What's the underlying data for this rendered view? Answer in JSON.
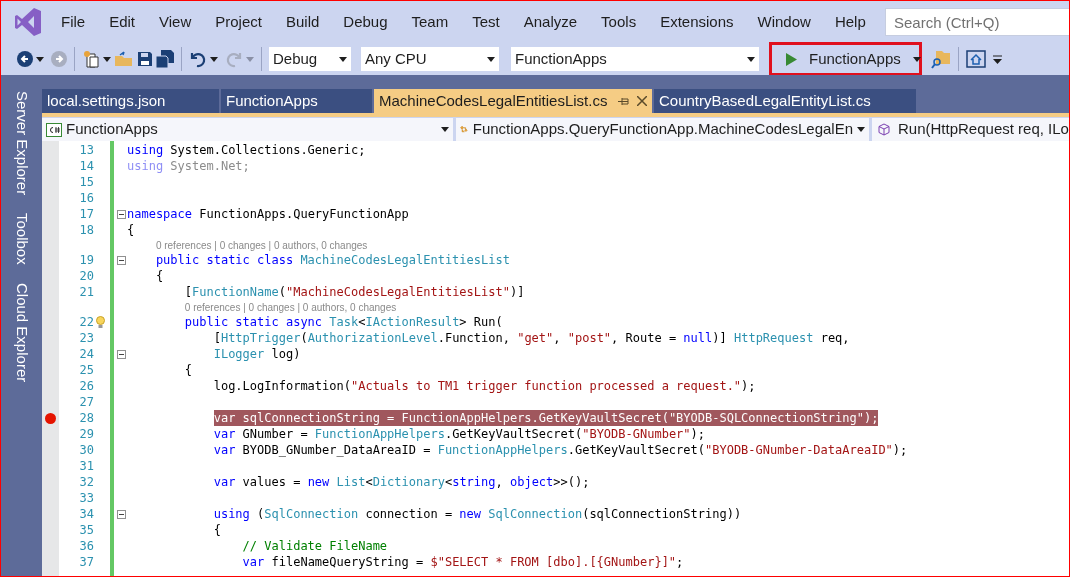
{
  "menu": [
    {
      "label": "File"
    },
    {
      "label": "Edit"
    },
    {
      "label": "View"
    },
    {
      "label": "Project"
    },
    {
      "label": "Build"
    },
    {
      "label": "Debug"
    },
    {
      "label": "Team"
    },
    {
      "label": "Test"
    },
    {
      "label": "Analyze"
    },
    {
      "label": "Tools"
    },
    {
      "label": "Extensions"
    },
    {
      "label": "Window"
    },
    {
      "label": "Help"
    }
  ],
  "search": {
    "placeholder": "Search (Ctrl+Q)"
  },
  "toolbar": {
    "configuration": "Debug",
    "platform": "Any CPU",
    "startup_project": "FunctionApps",
    "run_button": "FunctionApps"
  },
  "tool_windows": [
    "Server Explorer",
    "Toolbox",
    "Cloud Explorer"
  ],
  "tabs": [
    {
      "label": "local.settings.json",
      "selected": false
    },
    {
      "label": "FunctionApps",
      "selected": false
    },
    {
      "label": "MachineCodesLegalEntitiesList.cs",
      "selected": true
    },
    {
      "label": "CountryBasedLegalEntityList.cs",
      "selected": false
    }
  ],
  "nav_bar": {
    "project": "FunctionApps",
    "type": "FunctionApps.QueryFunctionApp.MachineCodesLegalEn",
    "member": "Run(HttpRequest req, ILo"
  },
  "code_lines": [
    {
      "kind": "code",
      "number": "13",
      "tokens": [
        {
          "kind": "keyword",
          "text": "using"
        },
        {
          "kind": "plain",
          "text": " System.Collections.Generic;"
        }
      ]
    },
    {
      "kind": "code",
      "number": "14",
      "tokens": [
        {
          "kind": "unused_keyword",
          "text": "using"
        },
        {
          "kind": "unused",
          "text": " System.Net;"
        }
      ]
    },
    {
      "kind": "code",
      "number": "15"
    },
    {
      "kind": "code",
      "number": "16"
    },
    {
      "kind": "code",
      "number": "17",
      "fold": true,
      "tokens": [
        {
          "kind": "keyword",
          "text": "namespace"
        },
        {
          "kind": "plain",
          "text": " FunctionApps.QueryFunctionApp"
        }
      ]
    },
    {
      "kind": "code",
      "number": "18",
      "tokens": [
        {
          "kind": "plain",
          "text": "{"
        }
      ]
    },
    {
      "kind": "block",
      "children": [
        {
          "kind": "lens",
          "text": "0 references | 0 changes | 0 authors, 0 changes"
        },
        {
          "kind": "code",
          "number": "19",
          "fold": true,
          "tokens": [
            {
              "kind": "keyword",
              "text": "public static class"
            },
            {
              "kind": "type",
              "text": " MachineCodesLegalEntitiesList"
            }
          ]
        },
        {
          "kind": "code",
          "number": "20",
          "tokens": [
            {
              "kind": "plain",
              "text": "{"
            }
          ]
        },
        {
          "kind": "block",
          "children": [
            {
              "kind": "code",
              "number": "21",
              "tokens": [
                {
                  "kind": "plain",
                  "text": "["
                },
                {
                  "kind": "type",
                  "text": "FunctionName"
                },
                {
                  "kind": "plain",
                  "text": "("
                },
                {
                  "kind": "string",
                  "text": "\"MachineCodesLegalEntitiesList\""
                },
                {
                  "kind": "plain",
                  "text": ")]"
                }
              ]
            },
            {
              "kind": "lens",
              "text": "0 references | 0 changes | 0 authors, 0 changes"
            },
            {
              "kind": "code",
              "number": "22",
              "lightbulb": true,
              "tokens": [
                {
                  "kind": "keyword",
                  "text": "public static async "
                },
                {
                  "kind": "type",
                  "text": "Task"
                },
                {
                  "kind": "plain",
                  "text": "<"
                },
                {
                  "kind": "type",
                  "text": "IActionResult"
                },
                {
                  "kind": "plain",
                  "text": "> Run("
                }
              ]
            },
            {
              "kind": "block",
              "children": [
                {
                  "kind": "code",
                  "number": "23",
                  "tokens": [
                    {
                      "kind": "plain",
                      "text": "["
                    },
                    {
                      "kind": "type",
                      "text": "HttpTrigger"
                    },
                    {
                      "kind": "plain",
                      "text": "("
                    },
                    {
                      "kind": "type",
                      "text": "AuthorizationLevel"
                    },
                    {
                      "kind": "plain",
                      "text": ".Function, "
                    },
                    {
                      "kind": "string",
                      "text": "\"get\""
                    },
                    {
                      "kind": "plain",
                      "text": ", "
                    },
                    {
                      "kind": "string",
                      "text": "\"post\""
                    },
                    {
                      "kind": "plain",
                      "text": ", Route = "
                    },
                    {
                      "kind": "keyword",
                      "text": "null"
                    },
                    {
                      "kind": "plain",
                      "text": ")] "
                    },
                    {
                      "kind": "type",
                      "text": "HttpRequest"
                    },
                    {
                      "kind": "plain",
                      "text": " req,"
                    }
                  ]
                },
                {
                  "kind": "code",
                  "number": "24",
                  "fold": true,
                  "tokens": [
                    {
                      "kind": "type",
                      "text": "ILogger"
                    },
                    {
                      "kind": "plain",
                      "text": " log)"
                    }
                  ]
                }
              ]
            },
            {
              "kind": "code",
              "number": "25",
              "tokens": [
                {
                  "kind": "plain",
                  "text": "{"
                }
              ]
            },
            {
              "kind": "block",
              "children": [
                {
                  "kind": "code",
                  "number": "26",
                  "tokens": [
                    {
                      "kind": "plain",
                      "text": "log.LogInformation("
                    },
                    {
                      "kind": "string",
                      "text": "\"Actuals to TM1 trigger function processed a request.\""
                    },
                    {
                      "kind": "plain",
                      "text": ");"
                    }
                  ]
                },
                {
                  "kind": "code",
                  "number": "27"
                },
                {
                  "kind": "code",
                  "number": "28",
                  "breakpoint": true,
                  "tokens": [
                    {
                      "kind": "keyword",
                      "text": "var"
                    },
                    {
                      "kind": "plain",
                      "text": " sqlConnectionString = "
                    },
                    {
                      "kind": "type",
                      "text": "FunctionAppHelpers"
                    },
                    {
                      "kind": "plain",
                      "text": ".GetKeyVaultSecret("
                    },
                    {
                      "kind": "string",
                      "text": "\"BYODB-SQLConnectionString\""
                    },
                    {
                      "kind": "plain",
                      "text": ");"
                    }
                  ]
                },
                {
                  "kind": "code",
                  "number": "29",
                  "tokens": [
                    {
                      "kind": "keyword",
                      "text": "var"
                    },
                    {
                      "kind": "plain",
                      "text": " GNumber = "
                    },
                    {
                      "kind": "type",
                      "text": "FunctionAppHelpers"
                    },
                    {
                      "kind": "plain",
                      "text": ".GetKeyVaultSecret("
                    },
                    {
                      "kind": "string",
                      "text": "\"BYODB-GNumber\""
                    },
                    {
                      "kind": "plain",
                      "text": ");"
                    }
                  ]
                },
                {
                  "kind": "code",
                  "number": "30",
                  "tokens": [
                    {
                      "kind": "keyword",
                      "text": "var"
                    },
                    {
                      "kind": "plain",
                      "text": " BYODB_GNumber_DataAreaID = "
                    },
                    {
                      "kind": "type",
                      "text": "FunctionAppHelpers"
                    },
                    {
                      "kind": "plain",
                      "text": ".GetKeyVaultSecret("
                    },
                    {
                      "kind": "string",
                      "text": "\"BYODB-GNumber-DataAreaID\""
                    },
                    {
                      "kind": "plain",
                      "text": ");"
                    }
                  ]
                },
                {
                  "kind": "code",
                  "number": "31"
                },
                {
                  "kind": "code",
                  "number": "32",
                  "tokens": [
                    {
                      "kind": "keyword",
                      "text": "var"
                    },
                    {
                      "kind": "plain",
                      "text": " values = "
                    },
                    {
                      "kind": "keyword",
                      "text": "new "
                    },
                    {
                      "kind": "type",
                      "text": "List"
                    },
                    {
                      "kind": "plain",
                      "text": "<"
                    },
                    {
                      "kind": "type",
                      "text": "Dictionary"
                    },
                    {
                      "kind": "plain",
                      "text": "<"
                    },
                    {
                      "kind": "keyword",
                      "text": "string"
                    },
                    {
                      "kind": "plain",
                      "text": ", "
                    },
                    {
                      "kind": "keyword",
                      "text": "object"
                    },
                    {
                      "kind": "plain",
                      "text": ">>();"
                    }
                  ]
                },
                {
                  "kind": "code",
                  "number": "33"
                },
                {
                  "kind": "code",
                  "number": "34",
                  "fold": true,
                  "tokens": [
                    {
                      "kind": "keyword",
                      "text": "using"
                    },
                    {
                      "kind": "plain",
                      "text": " ("
                    },
                    {
                      "kind": "type",
                      "text": "SqlConnection"
                    },
                    {
                      "kind": "plain",
                      "text": " connection = "
                    },
                    {
                      "kind": "keyword",
                      "text": "new "
                    },
                    {
                      "kind": "type",
                      "text": "SqlConnection"
                    },
                    {
                      "kind": "plain",
                      "text": "(sqlConnectionString))"
                    }
                  ]
                },
                {
                  "kind": "code",
                  "number": "35",
                  "tokens": [
                    {
                      "kind": "plain",
                      "text": "{"
                    }
                  ]
                },
                {
                  "kind": "block",
                  "children": [
                    {
                      "kind": "code",
                      "number": "36",
                      "tokens": [
                        {
                          "kind": "comment",
                          "text": "// Validate FileName"
                        }
                      ]
                    },
                    {
                      "kind": "code",
                      "number": "37",
                      "tokens": [
                        {
                          "kind": "keyword",
                          "text": "var"
                        },
                        {
                          "kind": "plain",
                          "text": " fileNameQueryString = "
                        },
                        {
                          "kind": "string",
                          "text": "$\"SELECT * FROM [dbo].[{GNumber}]\""
                        },
                        {
                          "kind": "plain",
                          "text": ";"
                        }
                      ]
                    }
                  ]
                }
              ]
            }
          ]
        }
      ]
    }
  ]
}
